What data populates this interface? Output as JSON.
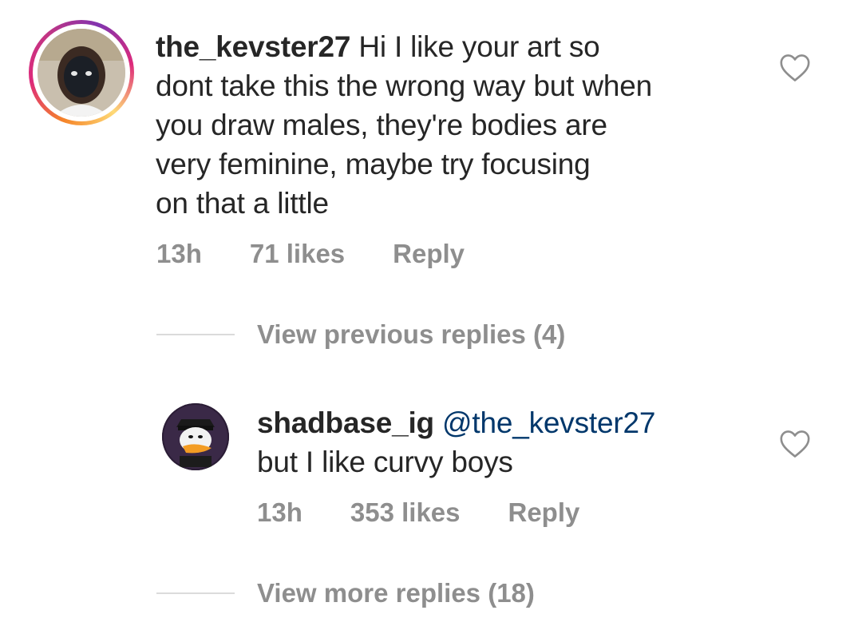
{
  "comment": {
    "username": "the_kevster27",
    "text_line1": " Hi I like your art so",
    "text_line2": "dont take this the wrong way but when",
    "text_line3": "you draw males, they're bodies are",
    "text_line4": "very feminine, maybe try focusing",
    "text_line5": "on that a little",
    "time": "13h",
    "likes": "71 likes",
    "reply_label": "Reply",
    "view_previous": "View previous replies (4)"
  },
  "reply": {
    "username": "shadbase_ig",
    "mention": "@the_kevster27",
    "text": "but I like curvy boys",
    "time": "13h",
    "likes": "353 likes",
    "reply_label": "Reply",
    "view_more": "View more replies (18)"
  },
  "colors": {
    "username": "#262626",
    "mention": "#00376b",
    "meta": "#8e8e8e",
    "divider": "#dbdbdb"
  },
  "icons": {
    "like": "heart-outline-icon"
  }
}
